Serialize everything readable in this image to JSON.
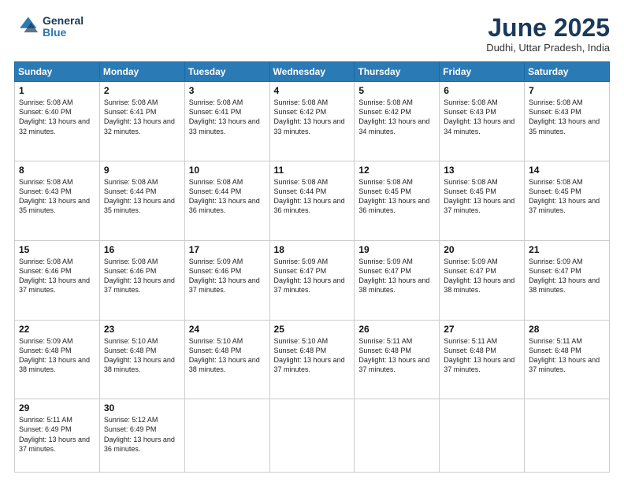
{
  "header": {
    "logo_line1": "General",
    "logo_line2": "Blue",
    "month": "June 2025",
    "location": "Dudhi, Uttar Pradesh, India"
  },
  "days_of_week": [
    "Sunday",
    "Monday",
    "Tuesday",
    "Wednesday",
    "Thursday",
    "Friday",
    "Saturday"
  ],
  "weeks": [
    [
      {
        "day": "1",
        "rise": "5:08 AM",
        "set": "6:40 PM",
        "daylight": "13 hours and 32 minutes."
      },
      {
        "day": "2",
        "rise": "5:08 AM",
        "set": "6:41 PM",
        "daylight": "13 hours and 32 minutes."
      },
      {
        "day": "3",
        "rise": "5:08 AM",
        "set": "6:41 PM",
        "daylight": "13 hours and 33 minutes."
      },
      {
        "day": "4",
        "rise": "5:08 AM",
        "set": "6:42 PM",
        "daylight": "13 hours and 33 minutes."
      },
      {
        "day": "5",
        "rise": "5:08 AM",
        "set": "6:42 PM",
        "daylight": "13 hours and 34 minutes."
      },
      {
        "day": "6",
        "rise": "5:08 AM",
        "set": "6:43 PM",
        "daylight": "13 hours and 34 minutes."
      },
      {
        "day": "7",
        "rise": "5:08 AM",
        "set": "6:43 PM",
        "daylight": "13 hours and 35 minutes."
      }
    ],
    [
      {
        "day": "8",
        "rise": "5:08 AM",
        "set": "6:43 PM",
        "daylight": "13 hours and 35 minutes."
      },
      {
        "day": "9",
        "rise": "5:08 AM",
        "set": "6:44 PM",
        "daylight": "13 hours and 35 minutes."
      },
      {
        "day": "10",
        "rise": "5:08 AM",
        "set": "6:44 PM",
        "daylight": "13 hours and 36 minutes."
      },
      {
        "day": "11",
        "rise": "5:08 AM",
        "set": "6:44 PM",
        "daylight": "13 hours and 36 minutes."
      },
      {
        "day": "12",
        "rise": "5:08 AM",
        "set": "6:45 PM",
        "daylight": "13 hours and 36 minutes."
      },
      {
        "day": "13",
        "rise": "5:08 AM",
        "set": "6:45 PM",
        "daylight": "13 hours and 37 minutes."
      },
      {
        "day": "14",
        "rise": "5:08 AM",
        "set": "6:45 PM",
        "daylight": "13 hours and 37 minutes."
      }
    ],
    [
      {
        "day": "15",
        "rise": "5:08 AM",
        "set": "6:46 PM",
        "daylight": "13 hours and 37 minutes."
      },
      {
        "day": "16",
        "rise": "5:08 AM",
        "set": "6:46 PM",
        "daylight": "13 hours and 37 minutes."
      },
      {
        "day": "17",
        "rise": "5:09 AM",
        "set": "6:46 PM",
        "daylight": "13 hours and 37 minutes."
      },
      {
        "day": "18",
        "rise": "5:09 AM",
        "set": "6:47 PM",
        "daylight": "13 hours and 37 minutes."
      },
      {
        "day": "19",
        "rise": "5:09 AM",
        "set": "6:47 PM",
        "daylight": "13 hours and 38 minutes."
      },
      {
        "day": "20",
        "rise": "5:09 AM",
        "set": "6:47 PM",
        "daylight": "13 hours and 38 minutes."
      },
      {
        "day": "21",
        "rise": "5:09 AM",
        "set": "6:47 PM",
        "daylight": "13 hours and 38 minutes."
      }
    ],
    [
      {
        "day": "22",
        "rise": "5:09 AM",
        "set": "6:48 PM",
        "daylight": "13 hours and 38 minutes."
      },
      {
        "day": "23",
        "rise": "5:10 AM",
        "set": "6:48 PM",
        "daylight": "13 hours and 38 minutes."
      },
      {
        "day": "24",
        "rise": "5:10 AM",
        "set": "6:48 PM",
        "daylight": "13 hours and 38 minutes."
      },
      {
        "day": "25",
        "rise": "5:10 AM",
        "set": "6:48 PM",
        "daylight": "13 hours and 37 minutes."
      },
      {
        "day": "26",
        "rise": "5:11 AM",
        "set": "6:48 PM",
        "daylight": "13 hours and 37 minutes."
      },
      {
        "day": "27",
        "rise": "5:11 AM",
        "set": "6:48 PM",
        "daylight": "13 hours and 37 minutes."
      },
      {
        "day": "28",
        "rise": "5:11 AM",
        "set": "6:48 PM",
        "daylight": "13 hours and 37 minutes."
      }
    ],
    [
      {
        "day": "29",
        "rise": "5:11 AM",
        "set": "6:49 PM",
        "daylight": "13 hours and 37 minutes."
      },
      {
        "day": "30",
        "rise": "5:12 AM",
        "set": "6:49 PM",
        "daylight": "13 hours and 36 minutes."
      },
      null,
      null,
      null,
      null,
      null
    ]
  ]
}
